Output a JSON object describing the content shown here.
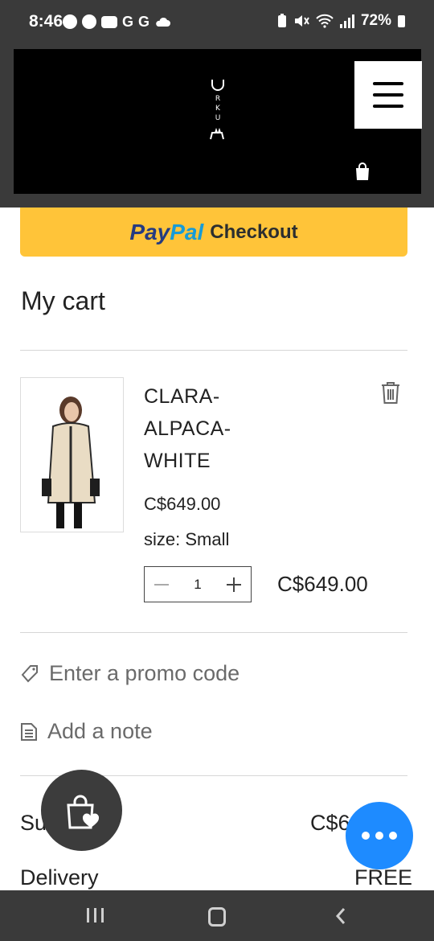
{
  "status_bar": {
    "time": "8:46",
    "notif_letters": [
      "G",
      "G"
    ],
    "battery": "72%"
  },
  "header": {
    "logo_text": "URKU",
    "brand_colors": {
      "header_bg": "#000000",
      "frame_bg": "#3a3a3a"
    }
  },
  "paypal": {
    "brand_pay": "Pay",
    "brand_pal": "Pal",
    "label": "Checkout",
    "color": "#ffc439"
  },
  "cart": {
    "title": "My cart",
    "item": {
      "name": "CLARA-ALPACA-WHITE",
      "price": "C$649.00",
      "size": "size: Small",
      "quantity": "1",
      "line_total": "C$649.00"
    },
    "promo_label": "Enter a promo code",
    "note_label": "Add a note",
    "subtotal_label": "Su",
    "subtotal_value": "C$6",
    "delivery_label": "Delivery",
    "delivery_value": "FREE"
  },
  "accent": {
    "chat_fab": "#1e8bff",
    "wishlist_fab": "#3c3c3c"
  }
}
